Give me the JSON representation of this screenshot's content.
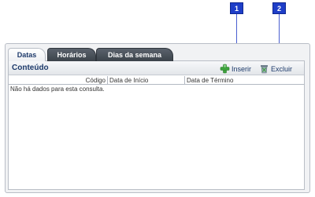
{
  "markers": [
    "1",
    "2"
  ],
  "tabs": [
    {
      "label": "Datas",
      "active": true
    },
    {
      "label": "Horários",
      "active": false
    },
    {
      "label": "Dias da semana",
      "active": false
    }
  ],
  "content": {
    "title": "Conteúdo",
    "actions": {
      "insert_label": "Inserir",
      "insert_icon": "green-plus-icon",
      "delete_label": "Excluir",
      "delete_icon": "trash-bin-icon"
    },
    "columns": [
      "Código",
      "Data de Início",
      "Data de Término"
    ],
    "empty_message": "Não há dados para esta consulta."
  },
  "colors": {
    "marker": "#1e3ec8",
    "tab_dark": "#3c434b",
    "title_text": "#1d3a6b",
    "plus_green": "#3da33d"
  }
}
